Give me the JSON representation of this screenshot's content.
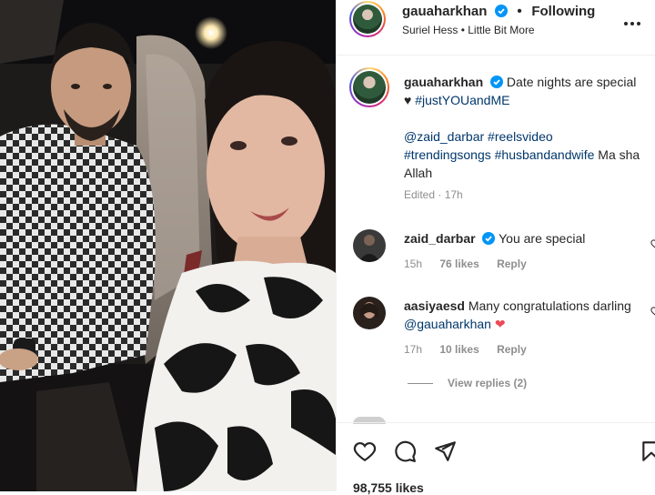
{
  "header": {
    "username": "gauaharkhan",
    "follow_status": "Following",
    "separator": "•",
    "audio_artist": "Suriel Hess",
    "audio_separator": "•",
    "audio_track": "Little Bit More",
    "more_icon": "more-horizontal-icon"
  },
  "caption": {
    "username": "gauaharkhan",
    "text_part1": "Date nights are special ♥",
    "hashtag1": "#justYOUandME",
    "mention": "@zaid_darbar",
    "hashtags_line": "#reelsvideo #trendingsongs #husbandandwife",
    "closing": "Ma sha Allah",
    "edited": "Edited · 17h"
  },
  "comments": [
    {
      "username": "zaid_darbar",
      "verified": true,
      "text": "You are special",
      "time": "15h",
      "likes": "76 likes",
      "reply": "Reply"
    },
    {
      "username": "aasiyaesd",
      "verified": false,
      "text": "Many congratulations darling",
      "mention": "@gauaharkhan",
      "emoji": "❤",
      "time": "17h",
      "likes": "10 likes",
      "reply": "Reply"
    }
  ],
  "view_replies": "View replies (2)",
  "actions": {
    "like_icon": "heart-icon",
    "comment_icon": "comment-icon",
    "share_icon": "send-icon",
    "save_icon": "bookmark-icon"
  },
  "likes_count": "98,755 likes",
  "colors": {
    "text": "#262626",
    "secondary": "#8e8e8e",
    "link": "#00376b",
    "verified": "#0095f6",
    "heart": "#ed4956"
  }
}
